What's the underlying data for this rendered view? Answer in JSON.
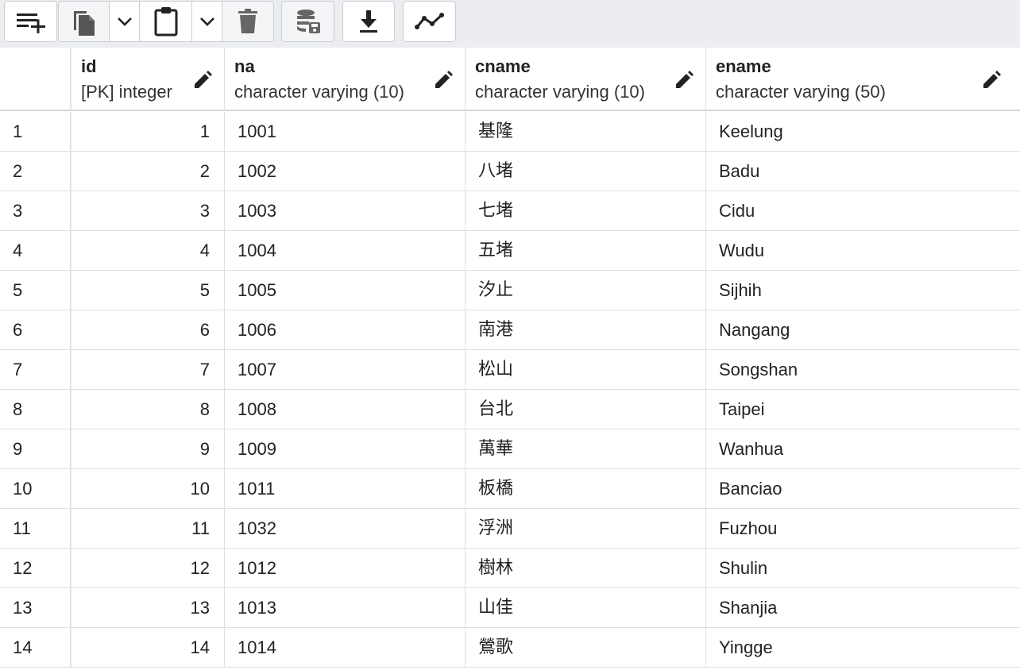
{
  "toolbar": {
    "buttons": [
      {
        "name": "add-row",
        "icon": "add-row-icon"
      },
      {
        "name": "copy",
        "icon": "copy-icon"
      },
      {
        "name": "copy-options",
        "icon": "chevron-down-icon"
      },
      {
        "name": "paste",
        "icon": "clipboard-icon"
      },
      {
        "name": "paste-options",
        "icon": "chevron-down-icon"
      },
      {
        "name": "delete",
        "icon": "trash-icon"
      },
      {
        "name": "save-data",
        "icon": "database-save-icon"
      },
      {
        "name": "download",
        "icon": "download-icon"
      },
      {
        "name": "graph-visualiser",
        "icon": "line-chart-icon"
      }
    ]
  },
  "columns": [
    {
      "key": "id",
      "name": "id",
      "type": "[PK] integer"
    },
    {
      "key": "na",
      "name": "na",
      "type": "character varying (10)"
    },
    {
      "key": "cname",
      "name": "cname",
      "type": "character varying (10)"
    },
    {
      "key": "ename",
      "name": "ename",
      "type": "character varying (50)"
    }
  ],
  "rows": [
    {
      "rownum": "1",
      "id": "1",
      "na": "1001",
      "cname": "基隆",
      "ename": "Keelung"
    },
    {
      "rownum": "2",
      "id": "2",
      "na": "1002",
      "cname": "八堵",
      "ename": "Badu"
    },
    {
      "rownum": "3",
      "id": "3",
      "na": "1003",
      "cname": "七堵",
      "ename": "Cidu"
    },
    {
      "rownum": "4",
      "id": "4",
      "na": "1004",
      "cname": "五堵",
      "ename": "Wudu"
    },
    {
      "rownum": "5",
      "id": "5",
      "na": "1005",
      "cname": "汐止",
      "ename": "Sijhih"
    },
    {
      "rownum": "6",
      "id": "6",
      "na": "1006",
      "cname": "南港",
      "ename": "Nangang"
    },
    {
      "rownum": "7",
      "id": "7",
      "na": "1007",
      "cname": "松山",
      "ename": "Songshan"
    },
    {
      "rownum": "8",
      "id": "8",
      "na": "1008",
      "cname": "台北",
      "ename": "Taipei"
    },
    {
      "rownum": "9",
      "id": "9",
      "na": "1009",
      "cname": "萬華",
      "ename": "Wanhua"
    },
    {
      "rownum": "10",
      "id": "10",
      "na": "1011",
      "cname": "板橋",
      "ename": "Banciao"
    },
    {
      "rownum": "11",
      "id": "11",
      "na": "1032",
      "cname": "浮洲",
      "ename": "Fuzhou"
    },
    {
      "rownum": "12",
      "id": "12",
      "na": "1012",
      "cname": "樹林",
      "ename": "Shulin"
    },
    {
      "rownum": "13",
      "id": "13",
      "na": "1013",
      "cname": "山佳",
      "ename": "Shanjia"
    },
    {
      "rownum": "14",
      "id": "14",
      "na": "1014",
      "cname": "鶯歌",
      "ename": "Yingge"
    }
  ]
}
